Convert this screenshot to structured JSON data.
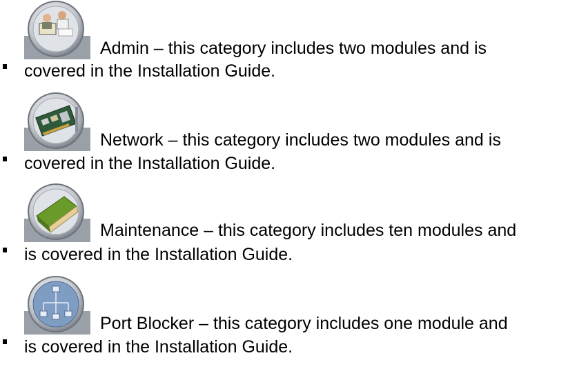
{
  "items": [
    {
      "icon": "admin-people-icon",
      "line1": "Admin – this category includes two modules and is",
      "line2": "covered in the Installation Guide."
    },
    {
      "icon": "network-card-icon",
      "line1": "Network – this category includes two modules and is",
      "line2": "covered in the Installation Guide."
    },
    {
      "icon": "maintenance-book-icon",
      "line1": "Maintenance – this category includes ten modules and",
      "line2": "is covered in the Installation Guide."
    },
    {
      "icon": "port-blocker-network-icon",
      "line1": "Port Blocker – this category includes one module and",
      "line2": "is covered in the Installation Guide."
    }
  ],
  "colors": {
    "icon_ring": "#8a8f98",
    "icon_tile": "#9aa0a8",
    "book_green": "#6a9a2a",
    "network_blue": "#6f8fb8"
  }
}
